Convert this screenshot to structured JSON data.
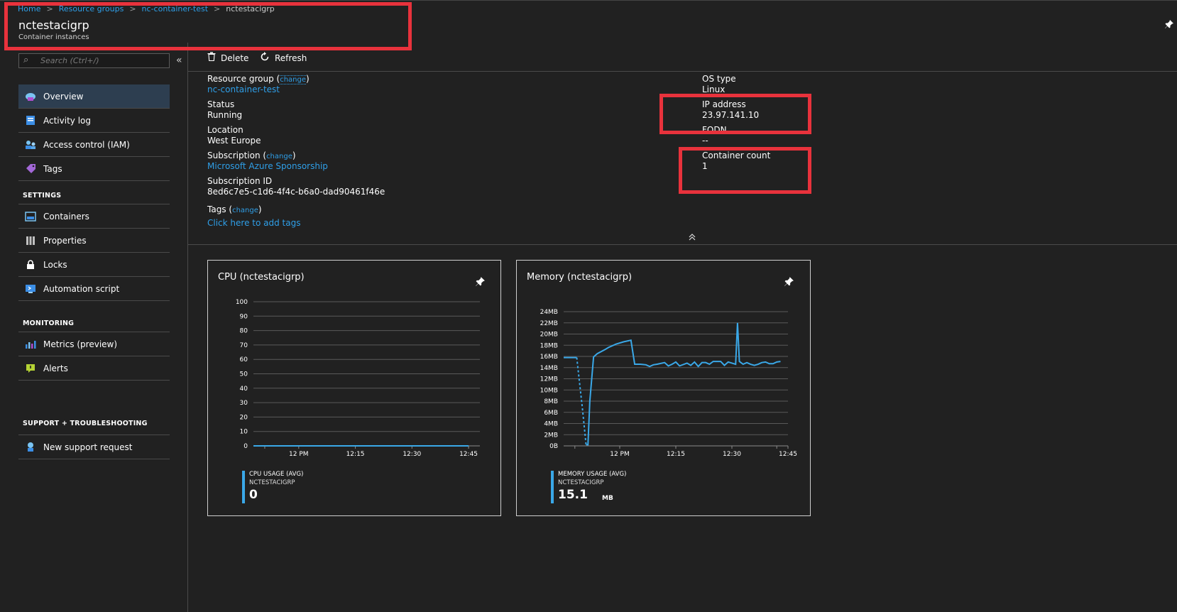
{
  "breadcrumb": {
    "items": [
      "Home",
      "Resource groups",
      "nc-container-test"
    ],
    "current": "nctestacigrp",
    "separator": ">"
  },
  "page": {
    "title": "nctestacigrp",
    "subtitle": "Container instances",
    "pin_icon": "pin-icon"
  },
  "search": {
    "placeholder": "Search (Ctrl+/)",
    "value": ""
  },
  "collapse_glyph": "«",
  "nav": {
    "top_items": [
      {
        "label": "Overview",
        "icon": "overview-icon",
        "selected": true
      },
      {
        "label": "Activity log",
        "icon": "activity-log-icon"
      },
      {
        "label": "Access control (IAM)",
        "icon": "iam-icon"
      },
      {
        "label": "Tags",
        "icon": "tag-icon"
      }
    ],
    "settings_header": "SETTINGS",
    "settings_items": [
      {
        "label": "Containers",
        "icon": "containers-icon"
      },
      {
        "label": "Properties",
        "icon": "properties-icon"
      },
      {
        "label": "Locks",
        "icon": "lock-icon"
      },
      {
        "label": "Automation script",
        "icon": "automation-script-icon"
      }
    ],
    "monitoring_header": "MONITORING",
    "monitoring_items": [
      {
        "label": "Metrics (preview)",
        "icon": "metrics-icon"
      },
      {
        "label": "Alerts",
        "icon": "alerts-icon"
      }
    ],
    "support_header": "SUPPORT + TROUBLESHOOTING",
    "support_items": [
      {
        "label": "New support request",
        "icon": "support-icon"
      }
    ]
  },
  "toolbar": {
    "delete_label": "Delete",
    "refresh_label": "Refresh"
  },
  "essentials": {
    "resource_group_label": "Resource group",
    "resource_group_value": "nc-container-test",
    "status_label": "Status",
    "status_value": "Running",
    "location_label": "Location",
    "location_value": "West Europe",
    "subscription_label": "Subscription",
    "subscription_value": "Microsoft Azure Sponsorship",
    "subscription_id_label": "Subscription ID",
    "subscription_id_value": "8ed6c7e5-c1d6-4f4c-b6a0-dad90461f46e",
    "tags_label": "Tags",
    "tags_link": "Click here to add tags",
    "change_label": "change",
    "os_type_label": "OS type",
    "os_type_value": "Linux",
    "ip_label": "IP address",
    "ip_value": "23.97.141.10",
    "fqdn_label": "FQDN",
    "fqdn_value": "--",
    "container_count_label": "Container count",
    "container_count_value": "1"
  },
  "colors": {
    "accent": "#2f9fe8",
    "highlight": "#e8323c",
    "series": "#3aa8e8"
  },
  "chart_data": [
    {
      "type": "line",
      "title": "CPU (nctestacigrp)",
      "x_ticks": [
        "12 PM",
        "12:15",
        "12:30",
        "12:45"
      ],
      "y_ticks": [
        "100",
        "90",
        "80",
        "70",
        "60",
        "50",
        "40",
        "30",
        "20",
        "10",
        "0"
      ],
      "ylim": [
        0,
        100
      ],
      "xlim_minutes": [
        -12,
        48
      ],
      "series": [
        {
          "x_minutes": [
            -12,
            -5,
            0,
            15,
            30,
            45
          ],
          "values": [
            0,
            0,
            0,
            0,
            0,
            0
          ]
        }
      ],
      "legend": {
        "metric": "CPU USAGE (AVG)",
        "resource": "NCTESTACIGRP",
        "value": "0",
        "unit": ""
      }
    },
    {
      "type": "line",
      "title": "Memory (nctestacigrp)",
      "x_ticks": [
        "12 PM",
        "12:15",
        "12:30",
        "12:45"
      ],
      "y_ticks": [
        "24MB",
        "22MB",
        "20MB",
        "18MB",
        "16MB",
        "14MB",
        "12MB",
        "10MB",
        "8MB",
        "6MB",
        "4MB",
        "2MB",
        "0B"
      ],
      "ylim": [
        0,
        24
      ],
      "xlim_minutes": [
        -15,
        45
      ],
      "series": [
        {
          "x_minutes": [
            -15,
            -12,
            -11.5,
            -10,
            -9,
            -8.5,
            -8,
            -7,
            -6,
            -4,
            -3,
            -1,
            1,
            3,
            4,
            5,
            5.5,
            7,
            8,
            9,
            10,
            12,
            13,
            14,
            15,
            16,
            18,
            19,
            20,
            21,
            22,
            23,
            24,
            25,
            27,
            28,
            29,
            30,
            31,
            31.5,
            32,
            33,
            34,
            35,
            36,
            37,
            38,
            39,
            40,
            41,
            42,
            43
          ],
          "values": [
            15.8,
            15.8,
            15.8,
            6.8,
            0.2,
            0.2,
            8.0,
            15.9,
            16.5,
            17.2,
            17.6,
            18.2,
            18.6,
            18.9,
            14.6,
            14.6,
            14.6,
            14.5,
            14.2,
            14.5,
            14.6,
            14.9,
            14.3,
            14.6,
            15.0,
            14.3,
            14.8,
            14.4,
            15.0,
            14.2,
            14.9,
            14.9,
            14.6,
            15.1,
            15.1,
            14.4,
            15.0,
            14.8,
            14.6,
            22.0,
            15.1,
            14.6,
            14.9,
            14.6,
            14.4,
            14.6,
            14.9,
            15.0,
            14.7,
            14.7,
            15.0,
            15.1
          ]
        }
      ],
      "dashed_segment_index_range": [
        2,
        4
      ],
      "legend": {
        "metric": "MEMORY USAGE (AVG)",
        "resource": "NCTESTACIGRP",
        "value": "15.1",
        "unit": "MB"
      }
    }
  ]
}
